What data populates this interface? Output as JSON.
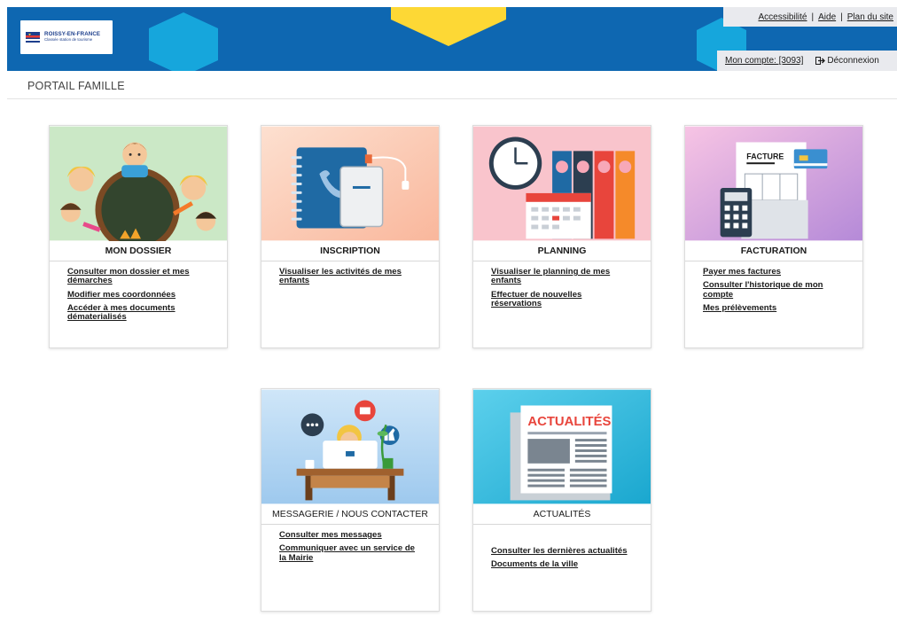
{
  "header": {
    "logo": {
      "title": "ROISSY-EN-FRANCE",
      "subtitle": "Classée station de tourisme"
    },
    "top_links": [
      {
        "label": "Accessibilité"
      },
      {
        "label": "Aide"
      },
      {
        "label": "Plan du site"
      }
    ],
    "top_links_separator": "|",
    "account": {
      "label": "Mon compte: [3093]",
      "logout": "Déconnexion"
    }
  },
  "breadcrumb": "PORTAIL FAMILLE",
  "colors": {
    "header_blue": "#0e67b1",
    "hex_light_blue": "#16a6dc",
    "hex_yellow": "#fdd835",
    "link_text": "#1a1a1a"
  },
  "cards": [
    {
      "title": "MON DOSSIER",
      "icon": "kids-chalkboard-illustration",
      "links": [
        {
          "label": "Consulter mon dossier et mes démarches"
        },
        {
          "label": "Modifier mes coordonnées"
        },
        {
          "label": "Accéder à mes documents dématerialisés"
        }
      ]
    },
    {
      "title": "INSCRIPTION",
      "icon": "notebook-phone-illustration",
      "links": [
        {
          "label": "Visualiser les activités de mes enfants"
        }
      ]
    },
    {
      "title": "PLANNING",
      "icon": "clock-calendar-binders-illustration",
      "links": [
        {
          "label": "Visualiser le planning de mes enfants"
        },
        {
          "label": "Effectuer de nouvelles réservations"
        }
      ]
    },
    {
      "title": "FACTURATION",
      "icon": "invoice-calculator-illustration",
      "illustration_text": "FACTURE",
      "links": [
        {
          "label": "Payer mes factures"
        },
        {
          "label": "Consulter l'historique de mon compte"
        },
        {
          "label": "Mes prélèvements"
        }
      ]
    },
    {
      "title": "MESSAGERIE / NOUS CONTACTER",
      "icon": "laptop-messages-illustration",
      "links": [
        {
          "label": "Consulter mes messages"
        },
        {
          "label": "Communiquer avec un service de la Mairie"
        }
      ]
    },
    {
      "title": "ACTUALITÉS",
      "icon": "newspaper-illustration",
      "illustration_text": "ACTUALITÉS",
      "links": [
        {
          "label": "Consulter les dernières actualités"
        },
        {
          "label": "Documents de la ville"
        }
      ]
    }
  ]
}
